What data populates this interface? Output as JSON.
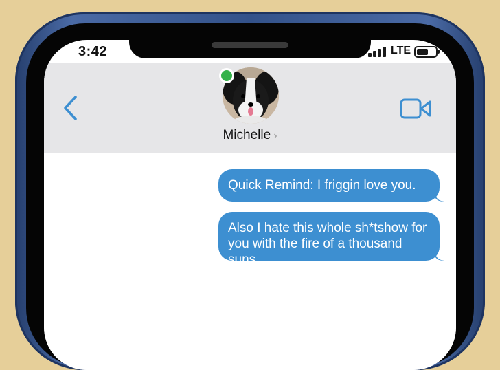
{
  "status_bar": {
    "time": "3:42",
    "network": "LTE"
  },
  "header": {
    "contact_name": "Michelle",
    "contact_chevron": "›"
  },
  "messages": [
    {
      "text": "Quick Remind: I friggin love you."
    },
    {
      "text": "Also I hate this whole sh*tshow for you with the fire of a thousand suns."
    }
  ],
  "colors": {
    "background": "#e6cf99",
    "bubble": "#3d8fd1",
    "accent": "#3d8fd1",
    "online_indicator": "#35b24a",
    "header_bg": "#e6e6e8"
  },
  "icons": {
    "back": "chevron-left-icon",
    "video": "video-camera-icon",
    "signal": "signal-bars-icon",
    "battery": "battery-icon"
  }
}
